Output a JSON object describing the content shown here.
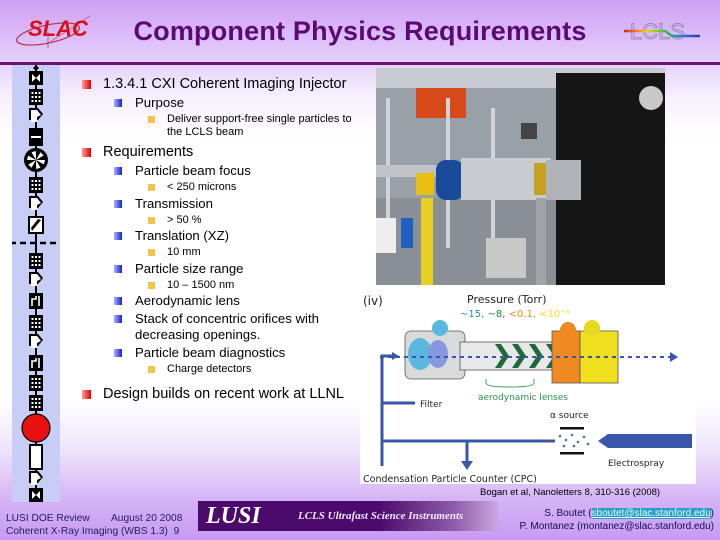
{
  "header": {
    "title": "Component Physics Requirements",
    "left_logo": "SLAC",
    "right_logo": "LCLS"
  },
  "beamline_icons": [
    "gate-valve-icon",
    "diagnostic-grid-icon",
    "flag-icon",
    "slit-icon",
    "wheel-icon",
    "diagnostic-grid-icon",
    "flag-icon",
    "mirror-icon",
    "dashed-boundary-icon",
    "diagnostic-grid-icon",
    "flag-icon",
    "aperture-icon",
    "diagnostic-grid-icon",
    "flag-icon",
    "aperture-icon",
    "diagnostic-grid-icon",
    "diagnostic-grid-icon",
    "sample-chamber-icon",
    "detector-icon",
    "flag-icon",
    "gate-valve-icon"
  ],
  "bullets": [
    {
      "level": 1,
      "text": "1.3.4.1 CXI Coherent Imaging Injector"
    },
    {
      "level": 2,
      "text": "Purpose"
    },
    {
      "level": 3,
      "text": "Deliver support-free single particles to the LCLS beam"
    },
    {
      "level": 1,
      "text": "Requirements"
    },
    {
      "level": 2,
      "text": "Particle beam focus"
    },
    {
      "level": 3,
      "text": "< 250 microns"
    },
    {
      "level": 2,
      "text": "Transmission"
    },
    {
      "level": 3,
      "text": "> 50 %"
    },
    {
      "level": 2,
      "text": "Translation (XZ)"
    },
    {
      "level": 3,
      "text": "10 mm"
    },
    {
      "level": 2,
      "text": "Particle size range"
    },
    {
      "level": 3,
      "text": "10 – 1500 nm"
    },
    {
      "level": 2,
      "text": "Aerodynamic lens"
    },
    {
      "level": 2,
      "text": "Stack of concentric orifices with decreasing openings."
    },
    {
      "level": 2,
      "text": "Particle beam diagnostics"
    },
    {
      "level": 3,
      "text": "Charge detectors"
    },
    {
      "level": 1,
      "text": "Design builds on recent work at LLNL"
    }
  ],
  "photo": {
    "description": "Injector hardware photo"
  },
  "diagram": {
    "panel_label": "(iv)",
    "pressure_title": "Pressure (Torr)",
    "pressures": [
      {
        "text": "~15,",
        "color": "#1a9aa0"
      },
      {
        "text": "~8,",
        "color": "#1c8a3c"
      },
      {
        "text": "<0.1,",
        "color": "#f08a1c"
      },
      {
        "text": "<10⁻³",
        "color": "#f2e020"
      }
    ],
    "lenses_label": "aerodynamic lenses",
    "filter_label": "Filter",
    "alpha_label": "α source",
    "electrospray_label": "Electrospray",
    "cpc_label": "Condensation Particle Counter (CPC)"
  },
  "citation": "Bogan et al, Nanoletters 8, 310-316 (2008)",
  "footer": {
    "review": "LUSI DOE Review",
    "date": "August 20 2008",
    "subtitle": "Coherent X-Ray Imaging (WBS 1.3)",
    "page": "9",
    "lusi": "LUSI",
    "lusi_sub": "LCLS Ultrafast Science Instruments",
    "author1": "S. Boutet (",
    "email1": "sboutet@slac.stanford.edu",
    "author1_end": ")",
    "author2": "P. Montanez (montanez@slac.stanford.edu)"
  }
}
